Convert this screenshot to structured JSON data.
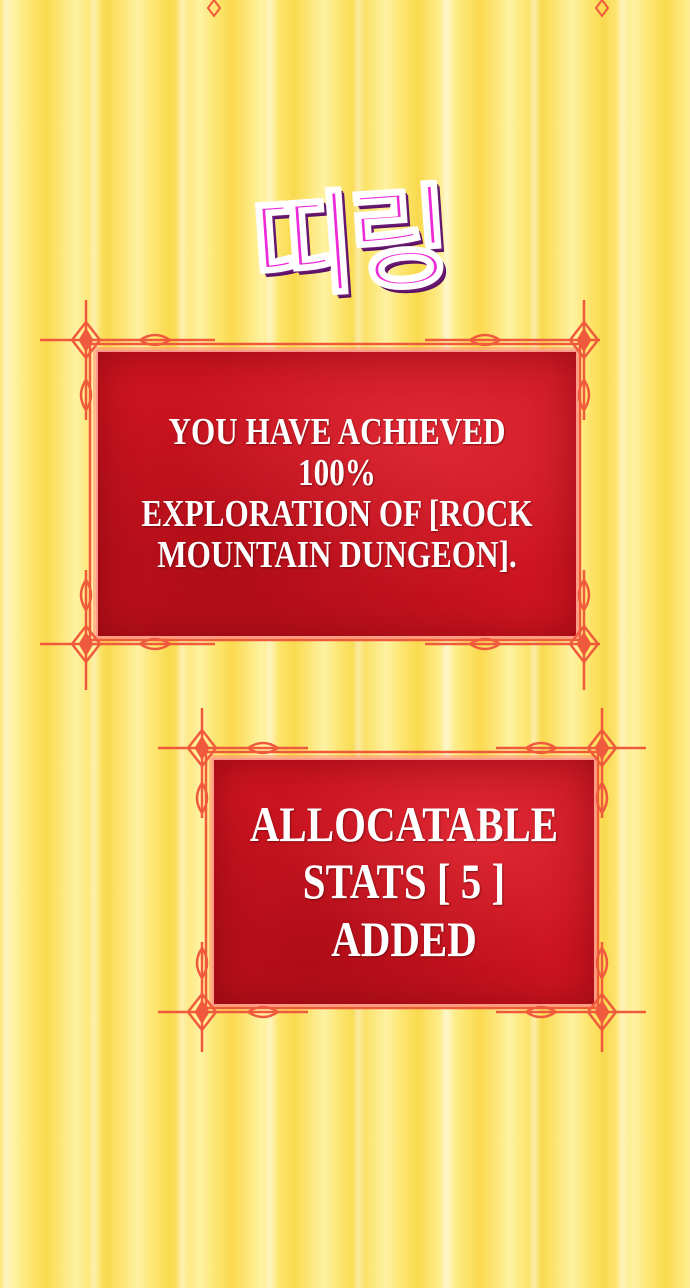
{
  "sound_effect": "띠링",
  "notifications": [
    {
      "lines": [
        "YOU HAVE ACHIEVED 100%",
        "EXPLORATION OF [ROCK",
        "MOUNTAIN DUNGEON]."
      ]
    },
    {
      "lines": [
        "ALLOCATABLE",
        "STATS [ 5 ] ADDED"
      ]
    }
  ],
  "colors": {
    "background": "#fde77a",
    "panel": "#cc1420",
    "frame": "#f05a3c",
    "sfx": "#ee2ad8"
  }
}
